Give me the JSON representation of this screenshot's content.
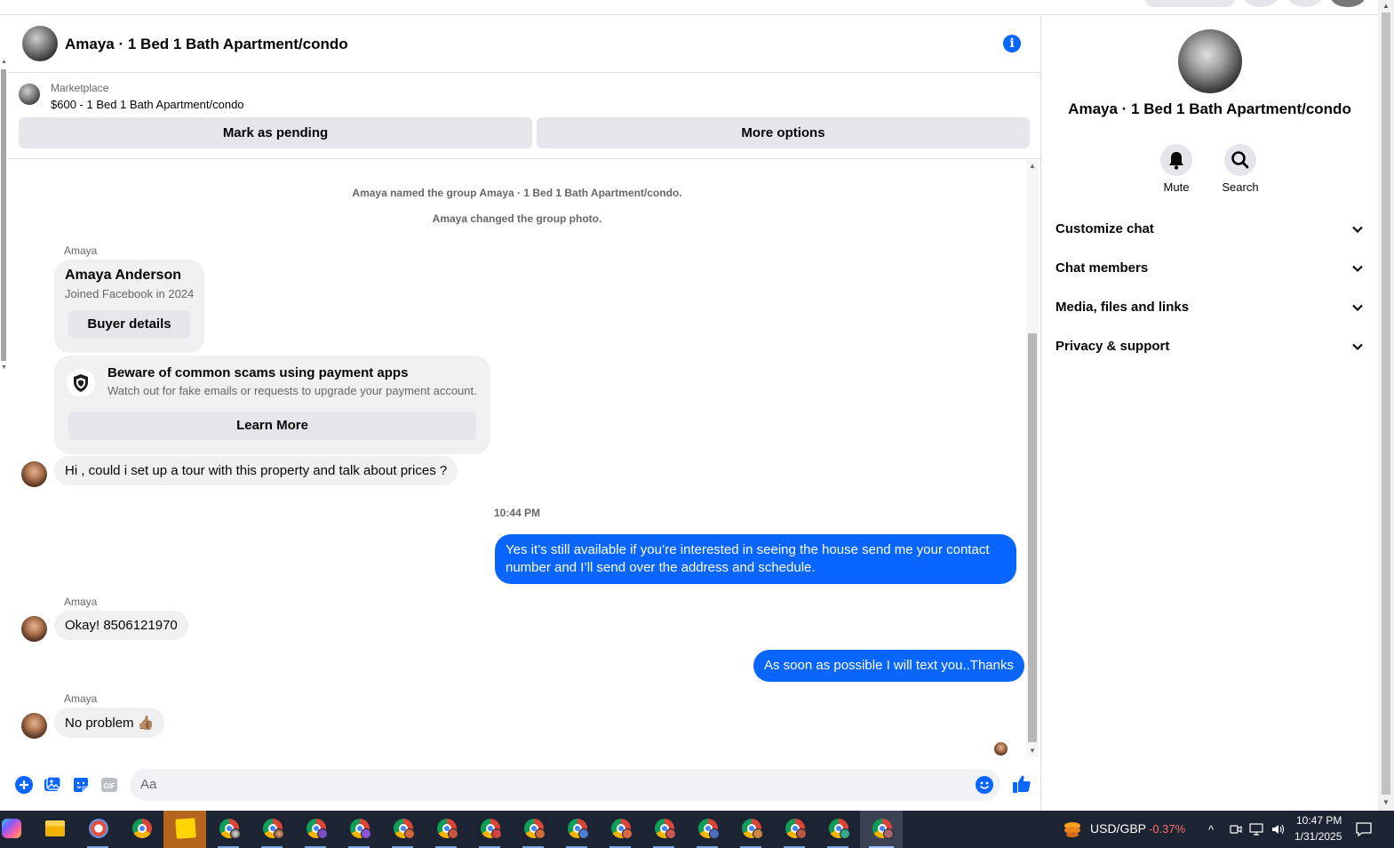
{
  "chat": {
    "title": "Amaya · 1 Bed 1 Bath Apartment/condo",
    "marketplace_label": "Marketplace",
    "listing": "$600 - 1 Bed 1 Bath Apartment/condo",
    "mark_pending": "Mark as pending",
    "more_options": "More options",
    "system_1": "Amaya named the group Amaya · 1 Bed 1 Bath Apartment/condo.",
    "system_2": "Amaya changed the group photo.",
    "sender_name": "Amaya",
    "buyer_card": {
      "name": "Amaya Anderson",
      "joined": "Joined Facebook in 2024",
      "button": "Buyer details"
    },
    "scam_card": {
      "title": "Beware of common scams using payment apps",
      "body": "Watch out for fake emails or requests to upgrade your payment account.",
      "button": "Learn More"
    },
    "messages": [
      {
        "from": "Amaya",
        "text": "Hi , could i set up a tour with this property and talk about prices ?"
      },
      {
        "from": "me",
        "text": "Yes it’s still available if you’re interested in seeing the house send me your contact number and I’ll send over the address and schedule."
      },
      {
        "from": "Amaya",
        "text": "Okay! 8506121970"
      },
      {
        "from": "me",
        "text": "As soon as possible I will text you..Thanks"
      },
      {
        "from": "Amaya",
        "text": "No problem 👍🏽"
      }
    ],
    "timestamp": "10:44 PM",
    "composer_placeholder": "Aa"
  },
  "right_panel": {
    "title": "Amaya · 1 Bed 1 Bath Apartment/condo",
    "mute": "Mute",
    "search": "Search",
    "sections": [
      "Customize chat",
      "Chat members",
      "Media, files and links",
      "Privacy & support"
    ]
  },
  "taskbar": {
    "ticker_symbol": "USD/GBP",
    "ticker_change": "-0.37%",
    "time": "10:47 PM",
    "date": "1/31/2025"
  },
  "colors": {
    "accent": "#0866ff",
    "bubble_in": "#f0f0f0",
    "ticker_negative": "#ff6b6b",
    "taskbar": "#1c2433"
  }
}
